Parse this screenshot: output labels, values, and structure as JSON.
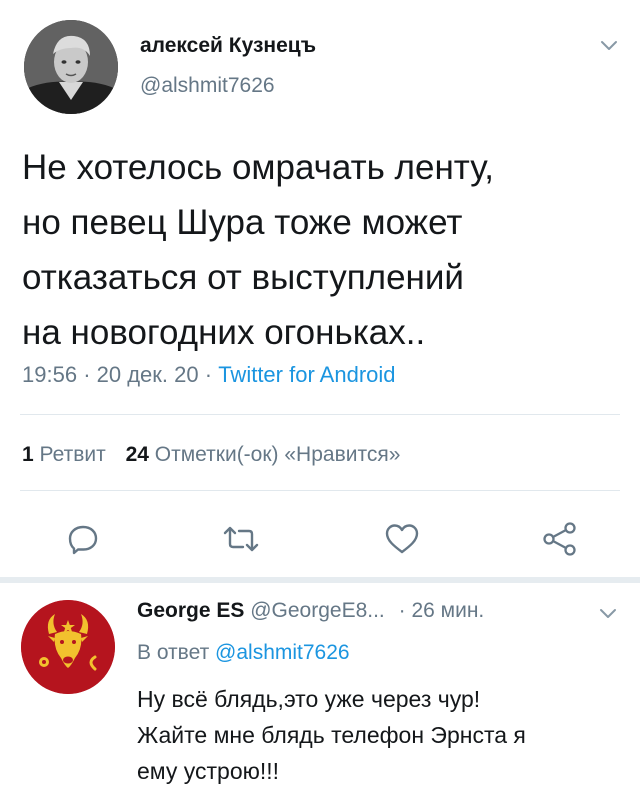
{
  "tweet": {
    "author_name": "алексей Кузнецъ",
    "author_handle": "@alshmit7626",
    "text_lines": [
      "Не хотелось омрачать ленту,",
      "но певец Шура тоже может",
      "отказаться от выступлений",
      "на новогодних огоньках.."
    ],
    "time": "19:56",
    "date": "20 дек. 20",
    "source": "Twitter for Android",
    "dot": "·"
  },
  "stats": {
    "retweets_count": "1",
    "retweets_label": "Ретвит",
    "likes_count": "24",
    "likes_label": "Отметки(-ок) «Нравится»"
  },
  "actions": [
    {
      "name": "reply",
      "icon": "reply-icon"
    },
    {
      "name": "retweet",
      "icon": "retweet-icon"
    },
    {
      "name": "like",
      "icon": "heart-icon"
    },
    {
      "name": "share",
      "icon": "share-icon"
    }
  ],
  "reply": {
    "author_name": "George ES",
    "author_handle": "@GeorgeE8...",
    "dot": "·",
    "time_ago": "26 мин.",
    "in_reply_prefix": "В ответ",
    "in_reply_handle": "@alshmit7626",
    "text_lines": [
      "Ну всё блядь,это уже через чур!",
      "Жайте мне блядь телефон Эрнста я",
      "ему устрою!!!"
    ]
  },
  "colors": {
    "link": "#1b95e0",
    "muted": "#657786",
    "emblem_red": "#b5141e",
    "emblem_gold": "#f2c12e"
  }
}
